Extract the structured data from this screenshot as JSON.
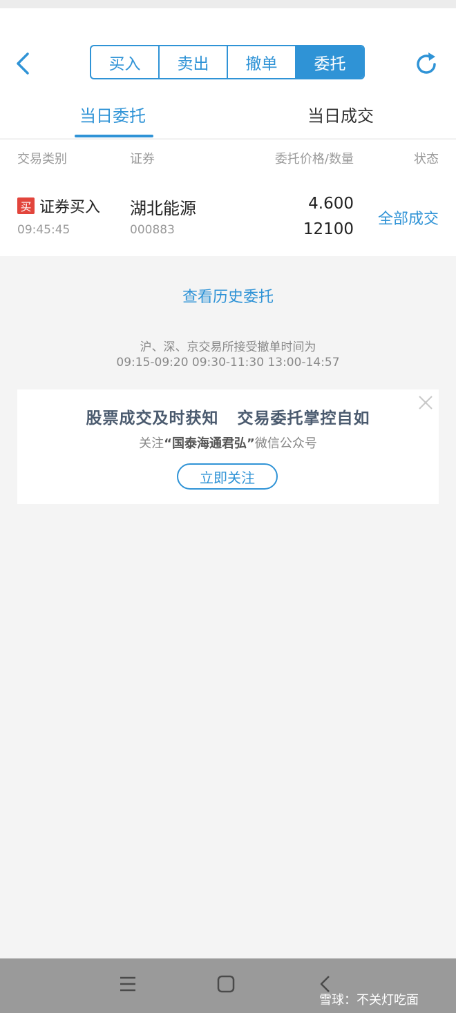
{
  "header": {
    "segments": [
      {
        "label": "买入",
        "active": false
      },
      {
        "label": "卖出",
        "active": false
      },
      {
        "label": "撤单",
        "active": false
      },
      {
        "label": "委托",
        "active": true
      }
    ],
    "subtabs": [
      {
        "label": "当日委托",
        "active": true
      },
      {
        "label": "当日成交",
        "active": false
      }
    ]
  },
  "table": {
    "columns": [
      "交易类别",
      "证券",
      "委托价格/数量",
      "状态"
    ],
    "rows": [
      {
        "badge": "买",
        "type": "证券买入",
        "time": "09:45:45",
        "name": "湖北能源",
        "code": "000883",
        "price": "4.600",
        "quantity": "12100",
        "status": "全部成交"
      }
    ]
  },
  "history_link": "查看历史委托",
  "notice": {
    "line1": "沪、深、京交易所接受撤单时间为",
    "line2": "09:15-09:20 09:30-11:30 13:00-14:57"
  },
  "promo": {
    "title": "股票成交及时获知   交易委托掌控自如",
    "sub_prefix": "关注",
    "sub_highlight": "“国泰海通君弘”",
    "sub_suffix": "微信公众号",
    "button": "立即关注"
  },
  "watermark": "雪球：不关灯吃面",
  "colors": {
    "accent": "#2f93d6",
    "buy_badge": "#e2453c",
    "background": "#f4f4f4"
  },
  "icons": [
    "back-arrow-icon",
    "refresh-icon",
    "close-icon",
    "menu-icon",
    "home-icon",
    "back-icon"
  ]
}
